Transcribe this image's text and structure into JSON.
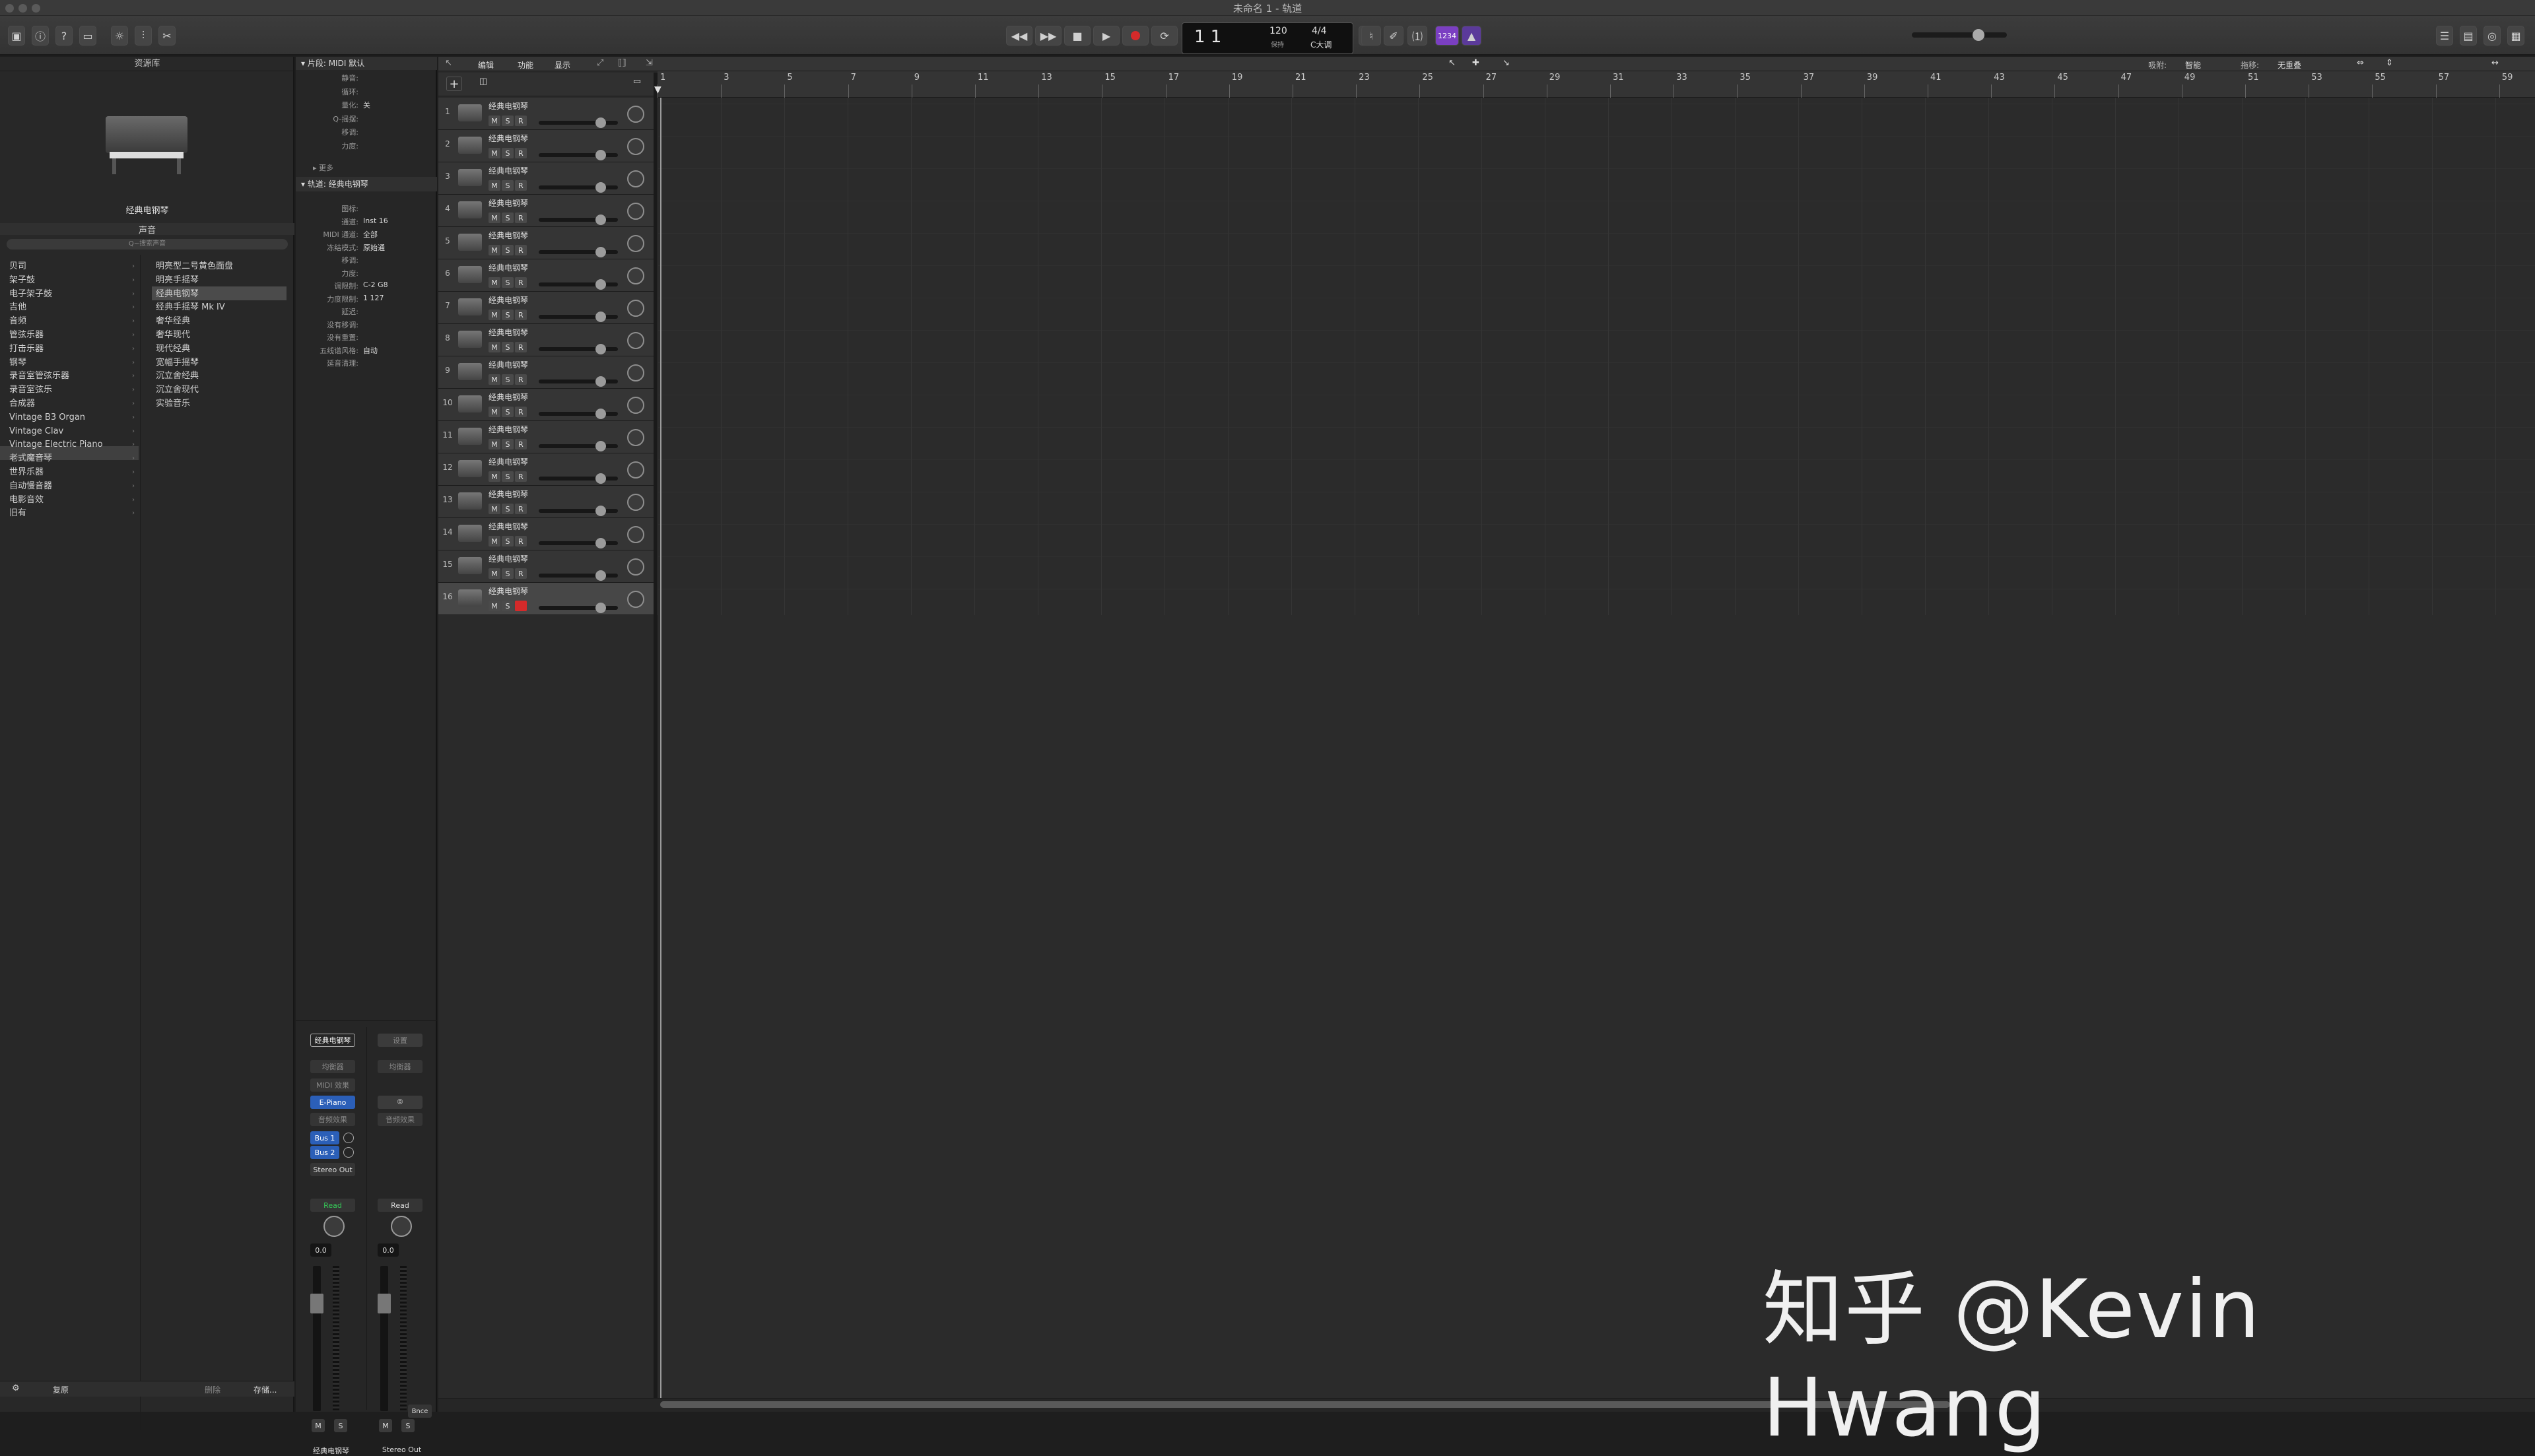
{
  "window": {
    "title": "未命名 1 - 轨道"
  },
  "transport": {
    "position": "1  1",
    "tempo": "120",
    "tempo_label": "保持",
    "signature": "4/4",
    "key": "C大调",
    "lcd_mode": "1234"
  },
  "library": {
    "title": "资源库",
    "preview_name": "经典电钢琴",
    "section": "声音",
    "search_placeholder": "Q~搜索声音",
    "categories": [
      "贝司",
      "架子鼓",
      "电子架子鼓",
      "吉他",
      "音频",
      "管弦乐器",
      "打击乐器",
      "钢琴",
      "录音室管弦乐器",
      "录音室弦乐",
      "合成器",
      "Vintage B3 Organ",
      "Vintage Clav",
      "Vintage Electric Piano",
      "老式魔音琴",
      "世界乐器",
      "自动慢音器",
      "电影音效",
      "旧有"
    ],
    "patches": [
      "明亮型二号黄色面盘",
      "明亮手摇琴",
      "经典电钢琴",
      "经典手摇琴 Mk IV",
      "奢华经典",
      "奢华现代",
      "现代经典",
      "宽幅手摇琴",
      "沉立舍经典",
      "沉立舍现代",
      "实验音乐"
    ],
    "footer": {
      "revert": "复原",
      "delete": "删除",
      "save": "存储..."
    }
  },
  "inspector": {
    "region_header": "片段: MIDI 默认",
    "region_rows": [
      {
        "label": "静音:",
        "value": ""
      },
      {
        "label": "循环:",
        "value": ""
      },
      {
        "label": "量化:",
        "value": "关"
      },
      {
        "label": "Q-摇摆:",
        "value": ""
      },
      {
        "label": "移调:",
        "value": ""
      },
      {
        "label": "力度:",
        "value": ""
      }
    ],
    "more_label": "更多",
    "track_header": "轨道: 经典电钢琴",
    "track_rows": [
      {
        "label": "图标:",
        "value": ""
      },
      {
        "label": "通道:",
        "value": "Inst 16"
      },
      {
        "label": "MIDI 通道:",
        "value": "全部"
      },
      {
        "label": "冻结模式:",
        "value": "原始通"
      },
      {
        "label": "移调:",
        "value": ""
      },
      {
        "label": "力度:",
        "value": ""
      },
      {
        "label": "调限制:",
        "value": "C-2  G8"
      },
      {
        "label": "力度限制:",
        "value": "1  127"
      },
      {
        "label": "延迟:",
        "value": ""
      },
      {
        "label": "没有移调:",
        "value": ""
      },
      {
        "label": "没有重置:",
        "value": ""
      },
      {
        "label": "五线谱风格:",
        "value": "自动"
      },
      {
        "label": "延音清理:",
        "value": ""
      }
    ],
    "strip1": {
      "name_button": "经典电钢琴",
      "setting": "设置",
      "eq": "均衡器",
      "midi_fx": "MIDI 效果",
      "instrument": "E-Piano",
      "audio_fx": "音频效果",
      "send1": "Bus 1",
      "send2": "Bus 2",
      "output": "Stereo Out",
      "automation": "Read",
      "pan_value": "0.0",
      "mute": "M",
      "solo": "S",
      "footer_name": "经典电钢琴"
    },
    "strip2": {
      "name_button": "设置",
      "eq": "均衡器",
      "link": "⦾",
      "audio_fx": "音频效果",
      "automation": "Read",
      "pan_value": "0.0",
      "bounce": "Bnce",
      "mute": "M",
      "solo": "S",
      "footer_name": "Stereo Out"
    }
  },
  "tracks_menu": {
    "edit": "编辑",
    "functions": "功能",
    "view": "显示",
    "snap_label": "吸附:",
    "snap_value": "智能",
    "drag_label": "拖移:",
    "drag_value": "无重叠"
  },
  "track_header_buttons": {
    "add": "+",
    "mute": "M",
    "solo": "S",
    "record": "R"
  },
  "tracks": [
    {
      "num": "1",
      "name": "经典电钢琴"
    },
    {
      "num": "2",
      "name": "经典电钢琴"
    },
    {
      "num": "3",
      "name": "经典电钢琴"
    },
    {
      "num": "4",
      "name": "经典电钢琴"
    },
    {
      "num": "5",
      "name": "经典电钢琴"
    },
    {
      "num": "6",
      "name": "经典电钢琴"
    },
    {
      "num": "7",
      "name": "经典电钢琴"
    },
    {
      "num": "8",
      "name": "经典电钢琴"
    },
    {
      "num": "9",
      "name": "经典电钢琴"
    },
    {
      "num": "10",
      "name": "经典电钢琴"
    },
    {
      "num": "11",
      "name": "经典电钢琴"
    },
    {
      "num": "12",
      "name": "经典电钢琴"
    },
    {
      "num": "13",
      "name": "经典电钢琴"
    },
    {
      "num": "14",
      "name": "经典电钢琴"
    },
    {
      "num": "15",
      "name": "经典电钢琴"
    },
    {
      "num": "16",
      "name": "经典电钢琴"
    }
  ],
  "ruler": {
    "bars": [
      "1",
      "3",
      "5",
      "7",
      "9",
      "11",
      "13",
      "15",
      "17",
      "19",
      "21",
      "23",
      "25",
      "27",
      "29",
      "31",
      "33",
      "35",
      "37",
      "39",
      "41",
      "43",
      "45",
      "47",
      "49",
      "51",
      "53",
      "55",
      "57",
      "59"
    ]
  },
  "watermark": "知乎 @Kevin Hwang",
  "colors": {
    "background": "#1e1e1e",
    "panel": "#282828",
    "record": "#d52a2a",
    "instrument_slot": "#2b5fb8",
    "lcd_accent": "#7b3fc2",
    "read": "#35c857"
  }
}
